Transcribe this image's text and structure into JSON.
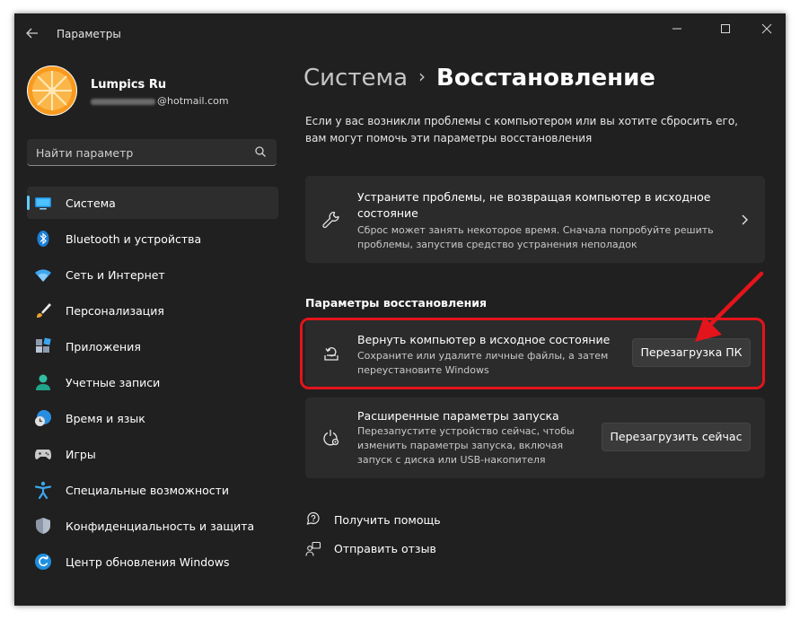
{
  "window": {
    "title": "Параметры"
  },
  "user": {
    "name": "Lumpics Ru",
    "email_domain": "@hotmail.com"
  },
  "search": {
    "placeholder": "Найти параметр"
  },
  "sidebar": {
    "items": [
      {
        "label": "Система",
        "icon": "monitor-icon",
        "active": true
      },
      {
        "label": "Bluetooth и устройства",
        "icon": "bluetooth-icon"
      },
      {
        "label": "Сеть и Интернет",
        "icon": "wifi-icon"
      },
      {
        "label": "Персонализация",
        "icon": "brush-icon"
      },
      {
        "label": "Приложения",
        "icon": "apps-icon"
      },
      {
        "label": "Учетные записи",
        "icon": "person-icon"
      },
      {
        "label": "Время и язык",
        "icon": "clock-globe-icon"
      },
      {
        "label": "Игры",
        "icon": "gamepad-icon"
      },
      {
        "label": "Специальные возможности",
        "icon": "accessibility-icon"
      },
      {
        "label": "Конфиденциальность и защита",
        "icon": "shield-icon"
      },
      {
        "label": "Центр обновления Windows",
        "icon": "update-icon"
      }
    ]
  },
  "breadcrumb": {
    "parent": "Система",
    "separator": "›",
    "current": "Восстановление"
  },
  "intro": "Если у вас возникли проблемы с компьютером или вы хотите сбросить его, вам могут помочь эти параметры восстановления",
  "troubleshoot_card": {
    "title": "Устраните проблемы, не возвращая компьютер в исходное состояние",
    "subtitle": "Сброс может занять некоторое время. Сначала попробуйте решить проблемы, запустив средство устранения неполадок"
  },
  "recovery_section": {
    "heading": "Параметры восстановления"
  },
  "reset_card": {
    "title": "Вернуть компьютер в исходное состояние",
    "subtitle": "Сохраните или удалите личные файлы, а затем переустановите Windows",
    "button": "Перезагрузка ПК"
  },
  "advanced_card": {
    "title": "Расширенные параметры запуска",
    "subtitle": "Перезапустите устройство сейчас, чтобы изменить параметры запуска, включая запуск с диска или USB-накопителя",
    "button": "Перезагрузить сейчас"
  },
  "links": {
    "help": "Получить помощь",
    "feedback": "Отправить отзыв"
  },
  "colors": {
    "accent": "#60cdff",
    "highlight": "#e3141b",
    "background": "#202020",
    "card": "#2b2b2b"
  }
}
